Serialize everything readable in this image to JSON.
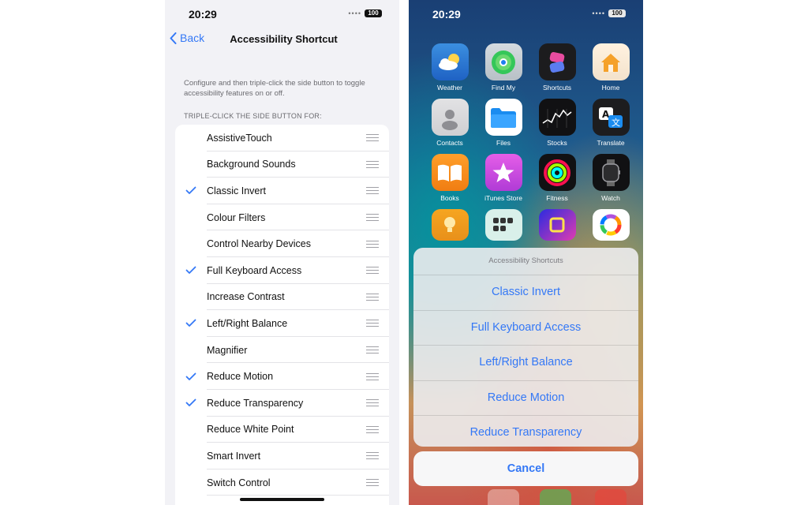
{
  "left_phone": {
    "status": {
      "time": "20:29",
      "battery": "100"
    },
    "nav": {
      "back_label": "Back",
      "title": "Accessibility Shortcut"
    },
    "description": "Configure and then triple-click the side button to toggle accessibility features on or off.",
    "section_header": "TRIPLE-CLICK THE SIDE BUTTON FOR:",
    "items": [
      {
        "label": "AssistiveTouch",
        "checked": false
      },
      {
        "label": "Background Sounds",
        "checked": false
      },
      {
        "label": "Classic Invert",
        "checked": true
      },
      {
        "label": "Colour Filters",
        "checked": false
      },
      {
        "label": "Control Nearby Devices",
        "checked": false
      },
      {
        "label": "Full Keyboard Access",
        "checked": true
      },
      {
        "label": "Increase Contrast",
        "checked": false
      },
      {
        "label": "Left/Right Balance",
        "checked": true
      },
      {
        "label": "Magnifier",
        "checked": false
      },
      {
        "label": "Reduce Motion",
        "checked": true
      },
      {
        "label": "Reduce Transparency",
        "checked": true
      },
      {
        "label": "Reduce White Point",
        "checked": false
      },
      {
        "label": "Smart Invert",
        "checked": false
      },
      {
        "label": "Switch Control",
        "checked": false
      }
    ]
  },
  "right_phone": {
    "status": {
      "time": "20:29",
      "battery": "100"
    },
    "apps": [
      {
        "label": "Weather",
        "icon": "weather-icon"
      },
      {
        "label": "Find My",
        "icon": "find-my-icon"
      },
      {
        "label": "Shortcuts",
        "icon": "shortcuts-icon"
      },
      {
        "label": "Home",
        "icon": "home-icon"
      },
      {
        "label": "Contacts",
        "icon": "contacts-icon"
      },
      {
        "label": "Files",
        "icon": "files-icon"
      },
      {
        "label": "Stocks",
        "icon": "stocks-icon"
      },
      {
        "label": "Translate",
        "icon": "translate-icon"
      },
      {
        "label": "Books",
        "icon": "books-icon"
      },
      {
        "label": "iTunes Store",
        "icon": "itunes-store-icon"
      },
      {
        "label": "Fitness",
        "icon": "fitness-icon"
      },
      {
        "label": "Watch",
        "icon": "watch-icon"
      }
    ],
    "sheet": {
      "title": "Accessibility Shortcuts",
      "options": [
        "Classic Invert",
        "Full Keyboard Access",
        "Left/Right Balance",
        "Reduce Motion",
        "Reduce Transparency"
      ],
      "cancel_label": "Cancel"
    }
  },
  "colors": {
    "accent": "#3478f6",
    "settings_bg": "#f2f2f6"
  }
}
